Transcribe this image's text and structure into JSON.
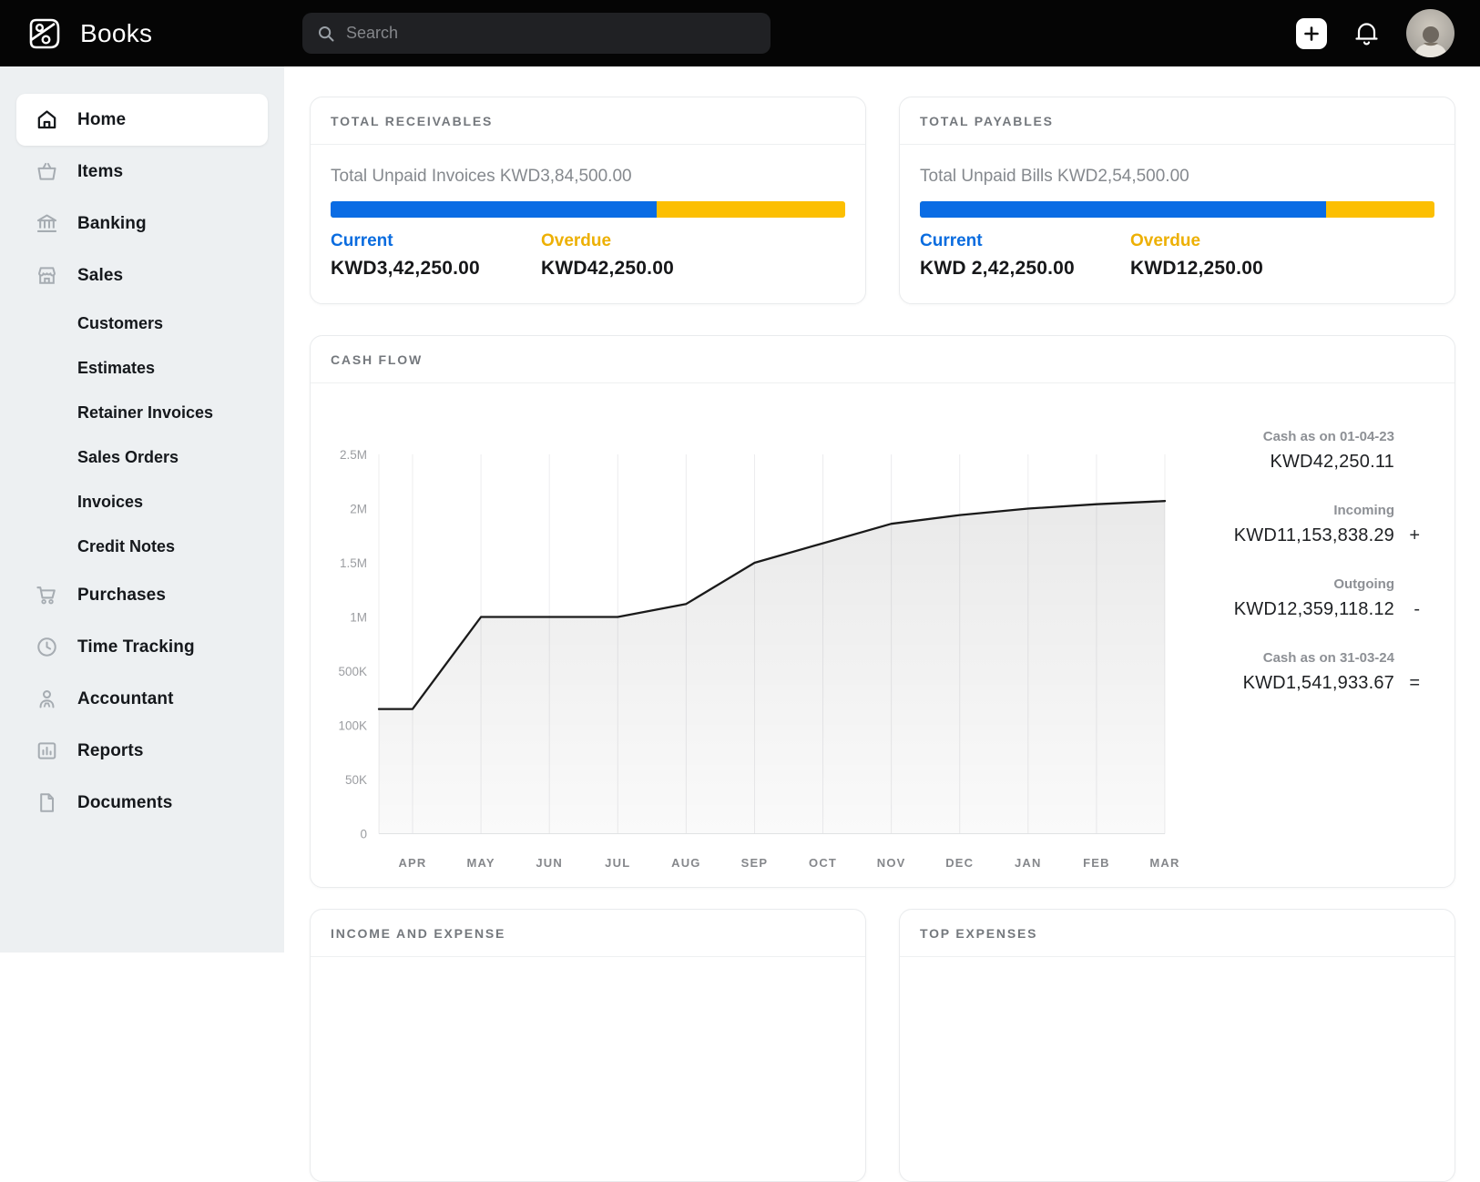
{
  "header": {
    "app_name": "Books",
    "search_placeholder": "Search"
  },
  "sidebar": {
    "items": [
      {
        "label": "Home",
        "icon": "home",
        "active": true
      },
      {
        "label": "Items",
        "icon": "basket"
      },
      {
        "label": "Banking",
        "icon": "bank"
      },
      {
        "label": "Sales",
        "icon": "store",
        "subs": [
          "Customers",
          "Estimates",
          "Retainer Invoices",
          "Sales Orders",
          "Invoices",
          "Credit Notes"
        ]
      },
      {
        "label": "Purchases",
        "icon": "cart"
      },
      {
        "label": "Time Tracking",
        "icon": "clock"
      },
      {
        "label": "Accountant",
        "icon": "person"
      },
      {
        "label": "Reports",
        "icon": "report"
      },
      {
        "label": "Documents",
        "icon": "doc"
      }
    ]
  },
  "receivables": {
    "title": "TOTAL RECEIVABLES",
    "summary": "Total Unpaid Invoices KWD3,84,500.00",
    "current_label": "Current",
    "current_value": "KWD3,42,250.00",
    "overdue_label": "Overdue",
    "overdue_value": "KWD42,250.00",
    "current_pct": "63.4%"
  },
  "payables": {
    "title": "TOTAL PAYABLES",
    "summary": "Total Unpaid Bills KWD2,54,500.00",
    "current_label": "Current",
    "current_value": "KWD 2,42,250.00",
    "overdue_label": "Overdue",
    "overdue_value": "KWD12,250.00",
    "current_pct": "79%"
  },
  "cashflow": {
    "title": "CASH FLOW",
    "stats": [
      {
        "label": "Cash as on 01-04-23",
        "value": "KWD42,250.11",
        "symbol": ""
      },
      {
        "label": "Incoming",
        "value": "KWD11,153,838.29",
        "symbol": "+"
      },
      {
        "label": "Outgoing",
        "value": "KWD12,359,118.12",
        "symbol": "-"
      },
      {
        "label": "Cash as on 31-03-24",
        "value": "KWD1,541,933.67",
        "symbol": "="
      }
    ]
  },
  "chart_data": {
    "type": "area",
    "title": "CASH FLOW",
    "months": [
      "APR",
      "MAY",
      "JUN",
      "JUL",
      "AUG",
      "SEP",
      "OCT",
      "NOV",
      "DEC",
      "JAN",
      "FEB",
      "MAR"
    ],
    "values": [
      220000,
      1000000,
      1000000,
      1000000,
      1120000,
      1500000,
      1680000,
      1860000,
      1940000,
      2000000,
      2040000,
      2070000
    ],
    "lead_value": 220000,
    "yticks": [
      {
        "label": "0",
        "value": 0
      },
      {
        "label": "50K",
        "value": 50000
      },
      {
        "label": "100K",
        "value": 100000
      },
      {
        "label": "500K",
        "value": 500000
      },
      {
        "label": "1M",
        "value": 1000000
      },
      {
        "label": "1.5M",
        "value": 1500000
      },
      {
        "label": "2M",
        "value": 2000000
      },
      {
        "label": "2.5M",
        "value": 2500000
      }
    ],
    "axis_note": "y axis ticks evenly spaced but non-linear in value, as displayed",
    "grid": "vertical-only",
    "line_color": "#1a1a1a",
    "xlabel": "",
    "ylabel": ""
  },
  "bottom_cards": {
    "income_expense_title": "INCOME AND EXPENSE",
    "top_expenses_title": "TOP EXPENSES"
  },
  "colors": {
    "accent_blue": "#0a6ce4",
    "accent_yellow": "#fcbf02",
    "overdue_text": "#edb004",
    "header_bg": "#050505",
    "sidebar_bg": "#edf0f2"
  }
}
